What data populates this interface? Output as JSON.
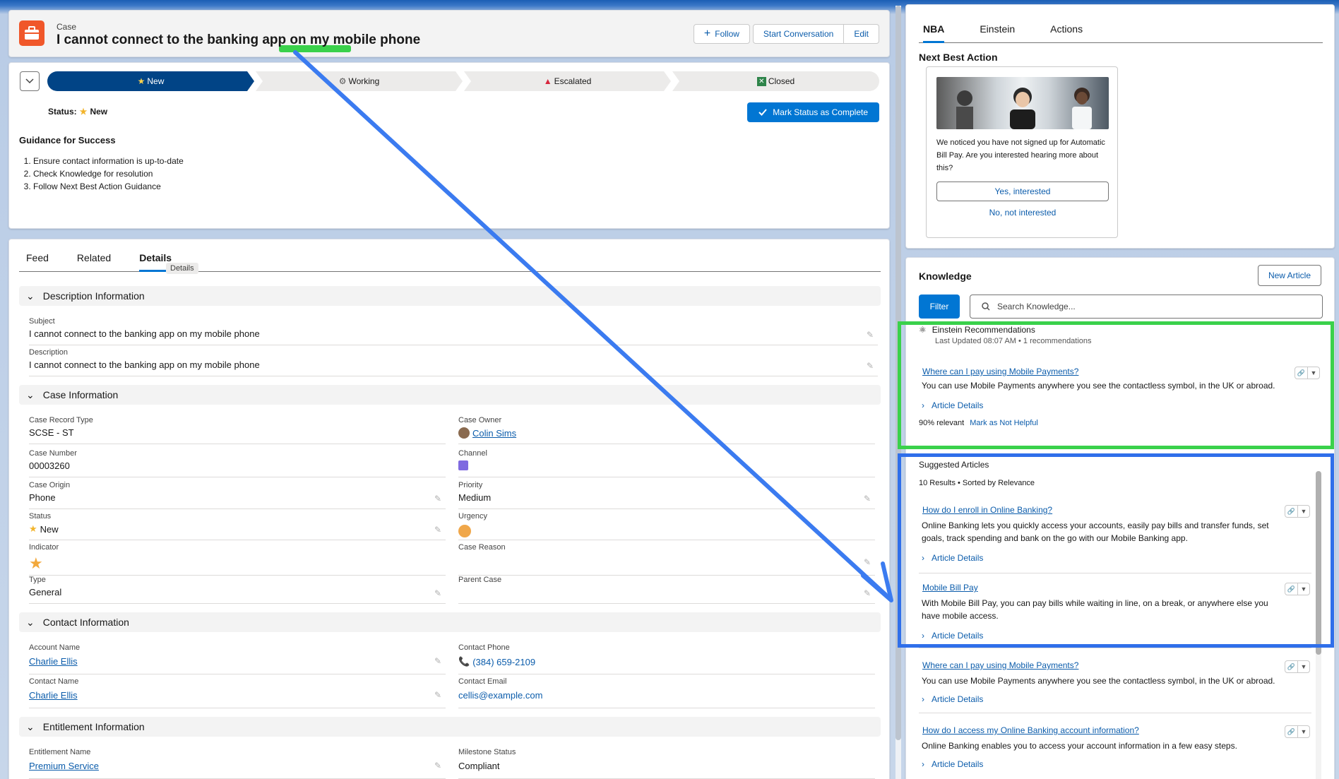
{
  "header": {
    "object_type": "Case",
    "title": "I cannot connect to the banking app on my mobile phone",
    "follow_label": "Follow",
    "start_conversation_label": "Start Conversation",
    "edit_label": "Edit"
  },
  "path": {
    "steps": [
      {
        "label": "New",
        "icon": "star-icon"
      },
      {
        "label": "Working",
        "icon": "gear-icon"
      },
      {
        "label": "Escalated",
        "icon": "warning-triangle-icon"
      },
      {
        "label": "Closed",
        "icon": "x-box-icon"
      }
    ],
    "active_index": 0,
    "status_label": "Status:",
    "status_value": "New",
    "mark_complete_label": "Mark Status as Complete"
  },
  "guidance": {
    "title": "Guidance for Success",
    "items": [
      "Ensure contact information is up-to-date",
      "Check Knowledge for resolution",
      "Follow Next Best Action Guidance"
    ]
  },
  "detail_tabs": {
    "tabs": [
      "Feed",
      "Related",
      "Details"
    ],
    "active": "Details",
    "tooltip": "Details"
  },
  "sections": {
    "description": {
      "title": "Description Information",
      "subject_label": "Subject",
      "subject_value": "I cannot connect to the banking app on my mobile phone",
      "description_label": "Description",
      "description_value": "I cannot connect to the banking app on my mobile phone"
    },
    "case_info": {
      "title": "Case Information",
      "record_type_label": "Case Record Type",
      "record_type_value": "SCSE - ST",
      "owner_label": "Case Owner",
      "owner_value": "Colin Sims",
      "number_label": "Case Number",
      "number_value": "00003260",
      "channel_label": "Channel",
      "origin_label": "Case Origin",
      "origin_value": "Phone",
      "priority_label": "Priority",
      "priority_value": "Medium",
      "status_label": "Status",
      "status_value": "New",
      "urgency_label": "Urgency",
      "indicator_label": "Indicator",
      "reason_label": "Case Reason",
      "type_label": "Type",
      "type_value": "General",
      "parent_label": "Parent Case"
    },
    "contact_info": {
      "title": "Contact Information",
      "account_label": "Account Name",
      "account_value": "Charlie Ellis",
      "phone_label": "Contact Phone",
      "phone_value": "(384) 659-2109",
      "contact_label": "Contact Name",
      "contact_value": "Charlie Ellis",
      "email_label": "Contact Email",
      "email_value": "cellis@example.com"
    },
    "entitlement_info": {
      "title": "Entitlement Information",
      "entitlement_label": "Entitlement Name",
      "entitlement_value": "Premium Service",
      "milestone_label": "Milestone Status",
      "milestone_value": "Compliant"
    }
  },
  "right_tabs": {
    "tabs": [
      "NBA",
      "Einstein",
      "Actions"
    ],
    "active": "NBA"
  },
  "nba": {
    "title": "Next Best Action",
    "text": "We noticed you have not signed up for Automatic Bill Pay. Are you interested hearing more about this?",
    "yes_label": "Yes, interested",
    "no_label": "No, not interested"
  },
  "knowledge": {
    "title": "Knowledge",
    "new_article_label": "New Article",
    "filter_label": "Filter",
    "search_placeholder": "Search Knowledge...",
    "recommendations_title": "Einstein Recommendations",
    "recommendations_sub": "Last Updated 08:07 AM • 1 recommendations",
    "recommended": {
      "title": "Where can I pay using Mobile Payments?",
      "body": "You can use Mobile Payments anywhere you see the contactless symbol, in the UK or abroad.",
      "details_label": "Article Details",
      "relevance": "90% relevant",
      "not_helpful_label": "Mark as Not Helpful"
    },
    "suggested_title": "Suggested Articles",
    "suggested_meta": "10 Results • Sorted by Relevance",
    "articles": [
      {
        "title": "How do I enroll in Online Banking?",
        "body": "Online Banking lets you quickly access your accounts, easily pay bills and transfer funds, set goals, track spending and bank on the go with our Mobile Banking app.",
        "details": "Article Details"
      },
      {
        "title": "Mobile Bill Pay",
        "body": "With Mobile Bill Pay, you can pay bills while waiting in line, on a break, or anywhere else you have mobile access.",
        "details": "Article Details"
      },
      {
        "title": "Where can I pay using Mobile Payments?",
        "body": "You can use Mobile Payments anywhere you see the contactless symbol, in the UK or abroad.",
        "details": "Article Details"
      },
      {
        "title": "How do I access my Online Banking account information?",
        "body": "Online Banking enables you to access your account information in a few easy steps.",
        "details": "Article Details"
      }
    ]
  },
  "colors": {
    "brand_blue": "#0176d3",
    "path_active": "#014486",
    "case_icon": "#f0572a",
    "highlight_green": "#3ad14b",
    "highlight_blue": "#2f6fea"
  }
}
